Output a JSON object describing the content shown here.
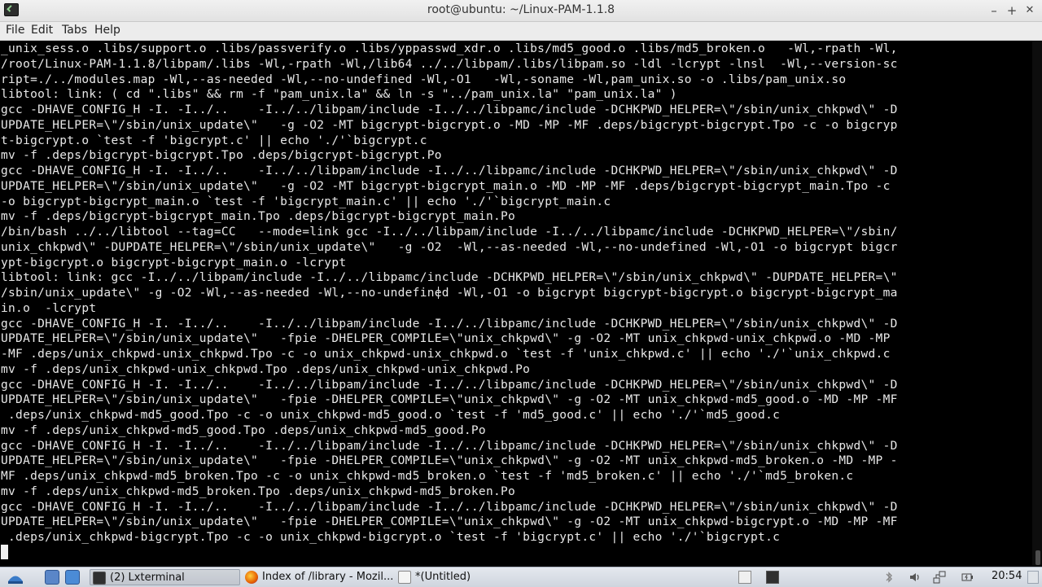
{
  "window": {
    "title": "root@ubuntu: ~/Linux-PAM-1.1.8",
    "minimize_glyph": "–",
    "maximize_glyph": "+",
    "close_glyph": "✕"
  },
  "menu": [
    "File",
    "Edit",
    "Tabs",
    "Help"
  ],
  "terminal": {
    "lines": [
      "_unix_sess.o .libs/support.o .libs/passverify.o .libs/yppasswd_xdr.o .libs/md5_good.o .libs/md5_broken.o   -Wl,-rpath -Wl,",
      "/root/Linux-PAM-1.1.8/libpam/.libs -Wl,-rpath -Wl,/lib64 ../../libpam/.libs/libpam.so -ldl -lcrypt -lnsl  -Wl,--version-sc",
      "ript=./../modules.map -Wl,--as-needed -Wl,--no-undefined -Wl,-O1   -Wl,-soname -Wl,pam_unix.so -o .libs/pam_unix.so",
      "libtool: link: ( cd \".libs\" && rm -f \"pam_unix.la\" && ln -s \"../pam_unix.la\" \"pam_unix.la\" )",
      "gcc -DHAVE_CONFIG_H -I. -I../..    -I../../libpam/include -I../../libpamc/include -DCHKPWD_HELPER=\\\"/sbin/unix_chkpwd\\\" -D",
      "UPDATE_HELPER=\\\"/sbin/unix_update\\\"   -g -O2 -MT bigcrypt-bigcrypt.o -MD -MP -MF .deps/bigcrypt-bigcrypt.Tpo -c -o bigcryp",
      "t-bigcrypt.o `test -f 'bigcrypt.c' || echo './'`bigcrypt.c",
      "mv -f .deps/bigcrypt-bigcrypt.Tpo .deps/bigcrypt-bigcrypt.Po",
      "gcc -DHAVE_CONFIG_H -I. -I../..    -I../../libpam/include -I../../libpamc/include -DCHKPWD_HELPER=\\\"/sbin/unix_chkpwd\\\" -D",
      "UPDATE_HELPER=\\\"/sbin/unix_update\\\"   -g -O2 -MT bigcrypt-bigcrypt_main.o -MD -MP -MF .deps/bigcrypt-bigcrypt_main.Tpo -c",
      "-o bigcrypt-bigcrypt_main.o `test -f 'bigcrypt_main.c' || echo './'`bigcrypt_main.c",
      "mv -f .deps/bigcrypt-bigcrypt_main.Tpo .deps/bigcrypt-bigcrypt_main.Po",
      "/bin/bash ../../libtool --tag=CC   --mode=link gcc -I../../libpam/include -I../../libpamc/include -DCHKPWD_HELPER=\\\"/sbin/",
      "unix_chkpwd\\\" -DUPDATE_HELPER=\\\"/sbin/unix_update\\\"   -g -O2  -Wl,--as-needed -Wl,--no-undefined -Wl,-O1 -o bigcrypt bigcr",
      "ypt-bigcrypt.o bigcrypt-bigcrypt_main.o -lcrypt",
      "libtool: link: gcc -I../../libpam/include -I../../libpamc/include -DCHKPWD_HELPER=\\\"/sbin/unix_chkpwd\\\" -DUPDATE_HELPER=\\\"",
      "/sbin/unix_update\\\" -g -O2 -Wl,--as-needed -Wl,--no-undefined -Wl,-O1 -o bigcrypt bigcrypt-bigcrypt.o bigcrypt-bigcrypt_ma",
      "in.o  -lcrypt",
      "gcc -DHAVE_CONFIG_H -I. -I../..    -I../../libpam/include -I../../libpamc/include -DCHKPWD_HELPER=\\\"/sbin/unix_chkpwd\\\" -D",
      "UPDATE_HELPER=\\\"/sbin/unix_update\\\"   -fpie -DHELPER_COMPILE=\\\"unix_chkpwd\\\" -g -O2 -MT unix_chkpwd-unix_chkpwd.o -MD -MP",
      "-MF .deps/unix_chkpwd-unix_chkpwd.Tpo -c -o unix_chkpwd-unix_chkpwd.o `test -f 'unix_chkpwd.c' || echo './'`unix_chkpwd.c",
      "mv -f .deps/unix_chkpwd-unix_chkpwd.Tpo .deps/unix_chkpwd-unix_chkpwd.Po",
      "gcc -DHAVE_CONFIG_H -I. -I../..    -I../../libpam/include -I../../libpamc/include -DCHKPWD_HELPER=\\\"/sbin/unix_chkpwd\\\" -D",
      "UPDATE_HELPER=\\\"/sbin/unix_update\\\"   -fpie -DHELPER_COMPILE=\\\"unix_chkpwd\\\" -g -O2 -MT unix_chkpwd-md5_good.o -MD -MP -MF",
      " .deps/unix_chkpwd-md5_good.Tpo -c -o unix_chkpwd-md5_good.o `test -f 'md5_good.c' || echo './'`md5_good.c",
      "mv -f .deps/unix_chkpwd-md5_good.Tpo .deps/unix_chkpwd-md5_good.Po",
      "gcc -DHAVE_CONFIG_H -I. -I../..    -I../../libpam/include -I../../libpamc/include -DCHKPWD_HELPER=\\\"/sbin/unix_chkpwd\\\" -D",
      "UPDATE_HELPER=\\\"/sbin/unix_update\\\"   -fpie -DHELPER_COMPILE=\\\"unix_chkpwd\\\" -g -O2 -MT unix_chkpwd-md5_broken.o -MD -MP -",
      "MF .deps/unix_chkpwd-md5_broken.Tpo -c -o unix_chkpwd-md5_broken.o `test -f 'md5_broken.c' || echo './'`md5_broken.c",
      "mv -f .deps/unix_chkpwd-md5_broken.Tpo .deps/unix_chkpwd-md5_broken.Po",
      "gcc -DHAVE_CONFIG_H -I. -I../..    -I../../libpam/include -I../../libpamc/include -DCHKPWD_HELPER=\\\"/sbin/unix_chkpwd\\\" -D",
      "UPDATE_HELPER=\\\"/sbin/unix_update\\\"   -fpie -DHELPER_COMPILE=\\\"unix_chkpwd\\\" -g -O2 -MT unix_chkpwd-bigcrypt.o -MD -MP -MF",
      " .deps/unix_chkpwd-bigcrypt.Tpo -c -o unix_chkpwd-bigcrypt.o `test -f 'bigcrypt.c' || echo './'`bigcrypt.c"
    ]
  },
  "taskbar": {
    "tasks": [
      {
        "label": "(2) Lxterminal",
        "icon": "terminal-icon"
      },
      {
        "label": "Index of /library - Mozil...",
        "icon": "firefox-icon"
      },
      {
        "label": "*(Untitled)",
        "icon": "text-editor-icon"
      }
    ],
    "clock": "20:54"
  },
  "colors": {
    "terminal_bg": "#000000",
    "terminal_fg": "#e8e8e8",
    "taskbar_bg": "#d8dde5"
  }
}
